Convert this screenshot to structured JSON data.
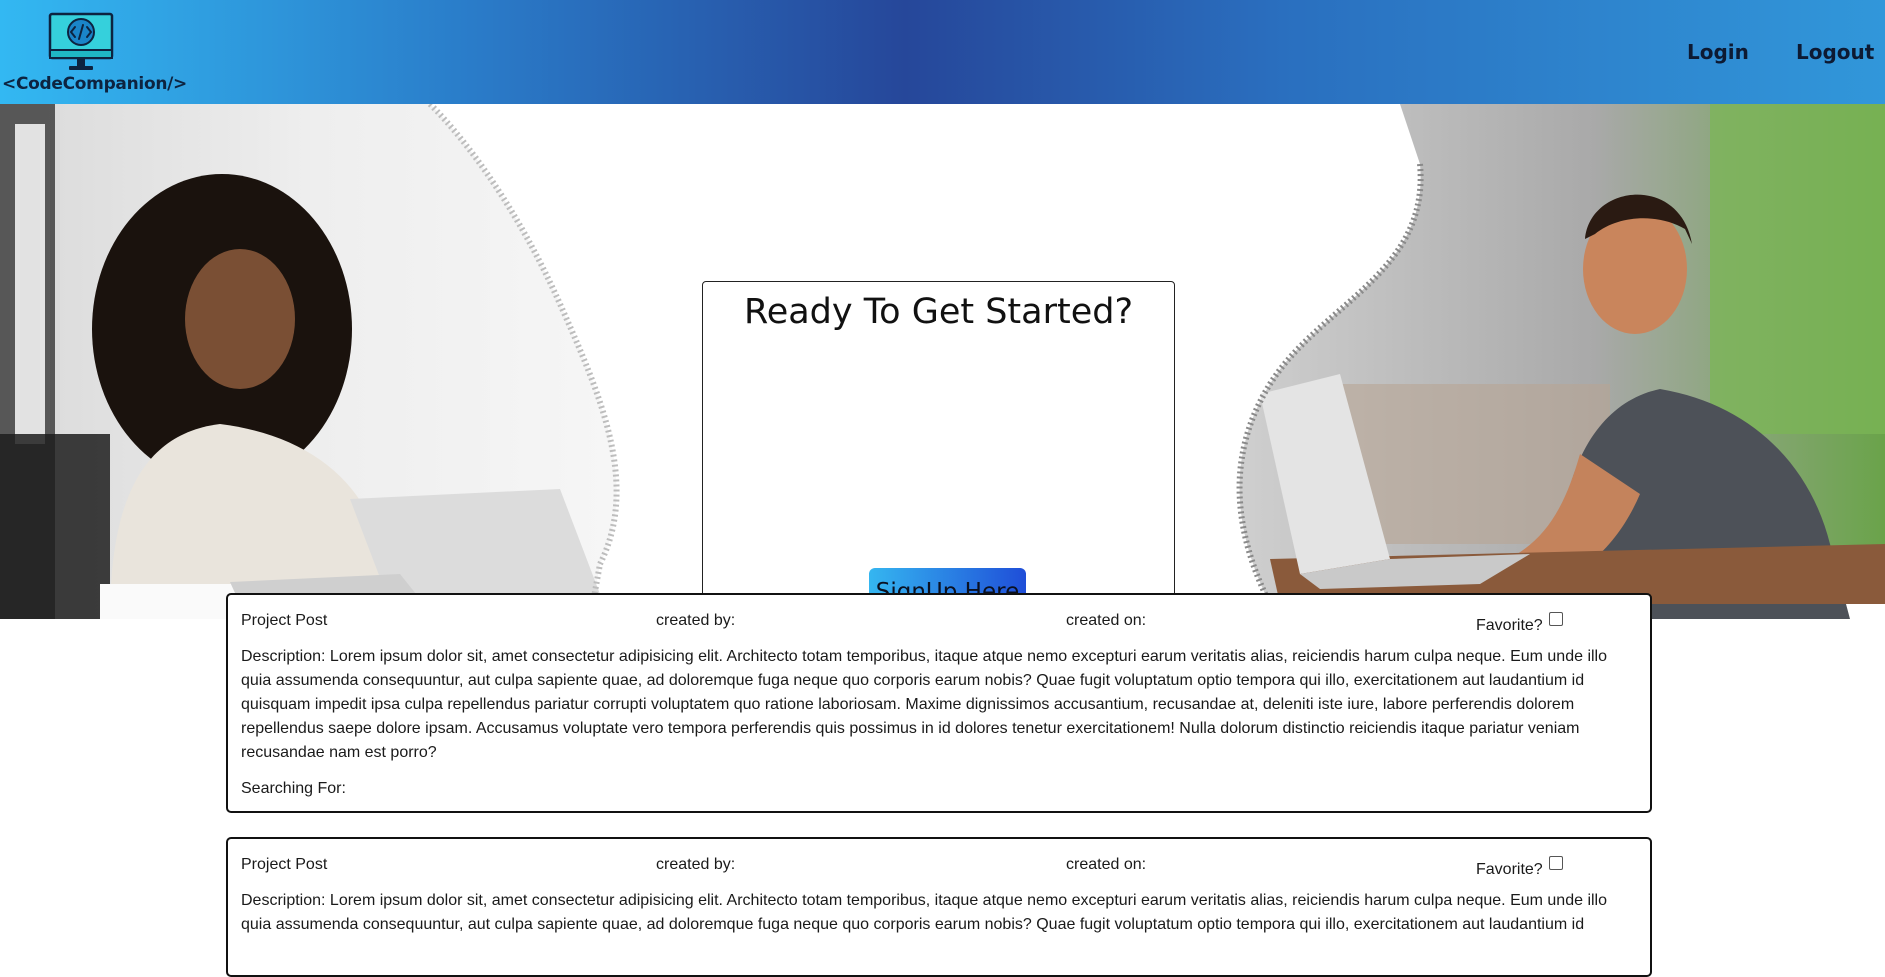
{
  "header": {
    "logo_text": "<CodeCompanion/>",
    "nav": {
      "login": "Login",
      "logout": "Logout"
    }
  },
  "hero": {
    "cta_title": "Ready To Get Started?",
    "cta_button": "SignUp Here"
  },
  "posts": [
    {
      "type_label": "Project Post",
      "created_by_label": "created by:",
      "created_on_label": "created on:",
      "favorite_label": "Favorite?",
      "description": "Description: Lorem ipsum dolor sit, amet consectetur adipisicing elit. Architecto totam temporibus, itaque atque nemo excepturi earum veritatis alias, reiciendis harum culpa neque. Eum unde illo quia assumenda consequuntur, aut culpa sapiente quae, ad doloremque fuga neque quo corporis earum nobis? Quae fugit voluptatum optio tempora qui illo, exercitationem aut laudantium id quisquam impedit ipsa culpa repellendus pariatur corrupti voluptatem quo ratione laboriosam. Maxime dignissimos accusantium, recusandae at, deleniti iste iure, labore perferendis dolorem repellendus saepe dolore ipsam. Accusamus voluptate vero tempora perferendis quis possimus in id dolores tenetur exercitationem! Nulla dolorum distinctio reiciendis itaque pariatur veniam recusandae nam est porro?",
      "searching_for_label": "Searching For:"
    },
    {
      "type_label": "Project Post",
      "created_by_label": "created by:",
      "created_on_label": "created on:",
      "favorite_label": "Favorite?",
      "description": "Description: Lorem ipsum dolor sit, amet consectetur adipisicing elit. Architecto totam temporibus, itaque atque nemo excepturi earum veritatis alias, reiciendis harum culpa neque. Eum unde illo quia assumenda consequuntur, aut culpa sapiente quae, ad doloremque fuga neque quo corporis earum nobis? Quae fugit voluptatum optio tempora qui illo, exercitationem aut laudantium id"
    }
  ]
}
